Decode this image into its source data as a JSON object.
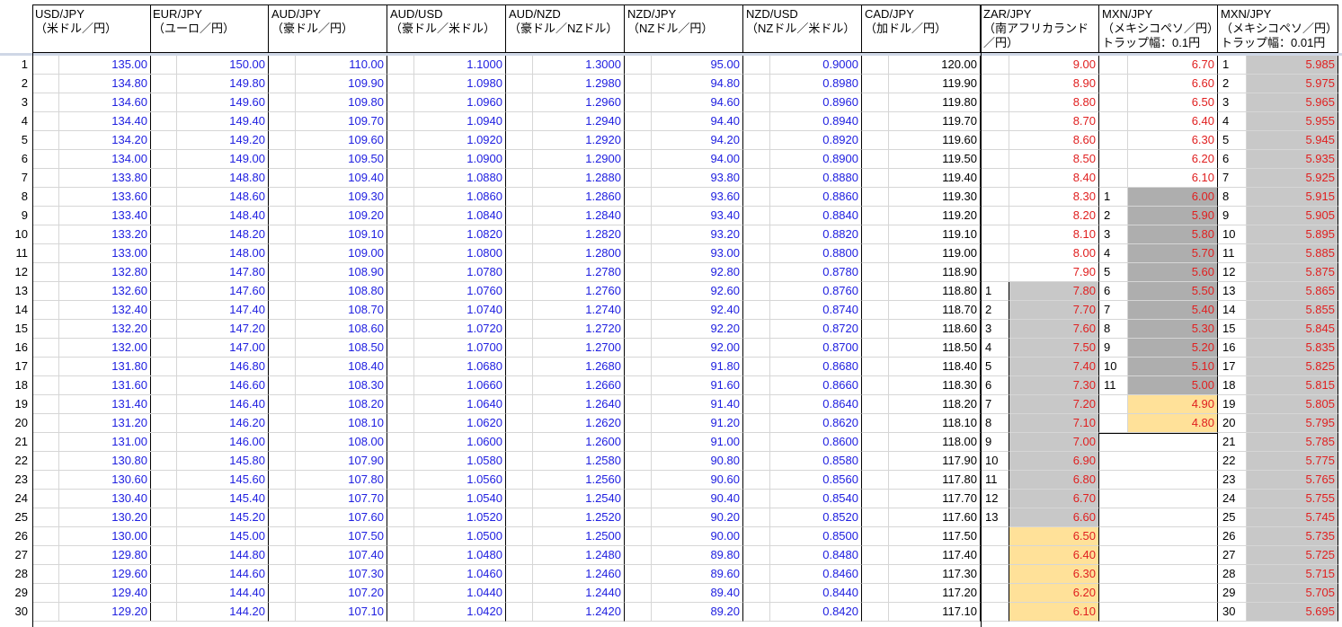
{
  "headers": [
    {
      "l1": "USD/JPY",
      "l2": "（米ドル／円）"
    },
    {
      "l1": "EUR/JPY",
      "l2": "（ユーロ／円）"
    },
    {
      "l1": "AUD/JPY",
      "l2": "（豪ドル／円）"
    },
    {
      "l1": "AUD/USD",
      "l2": "（豪ドル／米ドル）"
    },
    {
      "l1": "AUD/NZD",
      "l2": "（豪ドル／NZドル）"
    },
    {
      "l1": "NZD/JPY",
      "l2": "（NZドル／円）"
    },
    {
      "l1": "NZD/USD",
      "l2": "（NZドル／米ドル）"
    },
    {
      "l1": "CAD/JPY",
      "l2": "（加ドル／円）"
    },
    {
      "l1": "ZAR/JPY",
      "l2": "（南アフリカランド",
      "l3": "／円）"
    },
    {
      "l1": "MXN/JPY",
      "l2": "（メキシコペソ／円）",
      "l3": "トラップ幅：0.1円"
    },
    {
      "l1": "MXN/JPY",
      "l2": "（メキシコペソ／円）",
      "l3": "トラップ幅：0.01円"
    }
  ],
  "rownums": [
    "1",
    "2",
    "3",
    "4",
    "5",
    "6",
    "7",
    "8",
    "9",
    "10",
    "11",
    "12",
    "13",
    "14",
    "15",
    "16",
    "17",
    "18",
    "19",
    "20",
    "21",
    "22",
    "23",
    "24",
    "25",
    "26",
    "27",
    "28",
    "29",
    "30"
  ],
  "usdjpy": [
    "135.00",
    "134.80",
    "134.60",
    "134.40",
    "134.20",
    "134.00",
    "133.80",
    "133.60",
    "133.40",
    "133.20",
    "133.00",
    "132.80",
    "132.60",
    "132.40",
    "132.20",
    "132.00",
    "131.80",
    "131.60",
    "131.40",
    "131.20",
    "131.00",
    "130.80",
    "130.60",
    "130.40",
    "130.20",
    "130.00",
    "129.80",
    "129.60",
    "129.40",
    "129.20"
  ],
  "eurjpy": [
    "150.00",
    "149.80",
    "149.60",
    "149.40",
    "149.20",
    "149.00",
    "148.80",
    "148.60",
    "148.40",
    "148.20",
    "148.00",
    "147.80",
    "147.60",
    "147.40",
    "147.20",
    "147.00",
    "146.80",
    "146.60",
    "146.40",
    "146.20",
    "146.00",
    "145.80",
    "145.60",
    "145.40",
    "145.20",
    "145.00",
    "144.80",
    "144.60",
    "144.40",
    "144.20"
  ],
  "audjpy": [
    "110.00",
    "109.90",
    "109.80",
    "109.70",
    "109.60",
    "109.50",
    "109.40",
    "109.30",
    "109.20",
    "109.10",
    "109.00",
    "108.90",
    "108.80",
    "108.70",
    "108.60",
    "108.50",
    "108.40",
    "108.30",
    "108.20",
    "108.10",
    "108.00",
    "107.90",
    "107.80",
    "107.70",
    "107.60",
    "107.50",
    "107.40",
    "107.30",
    "107.20",
    "107.10"
  ],
  "audusd": [
    "1.1000",
    "1.0980",
    "1.0960",
    "1.0940",
    "1.0920",
    "1.0900",
    "1.0880",
    "1.0860",
    "1.0840",
    "1.0820",
    "1.0800",
    "1.0780",
    "1.0760",
    "1.0740",
    "1.0720",
    "1.0700",
    "1.0680",
    "1.0660",
    "1.0640",
    "1.0620",
    "1.0600",
    "1.0580",
    "1.0560",
    "1.0540",
    "1.0520",
    "1.0500",
    "1.0480",
    "1.0460",
    "1.0440",
    "1.0420"
  ],
  "audnzd": [
    "1.3000",
    "1.2980",
    "1.2960",
    "1.2940",
    "1.2920",
    "1.2900",
    "1.2880",
    "1.2860",
    "1.2840",
    "1.2820",
    "1.2800",
    "1.2780",
    "1.2760",
    "1.2740",
    "1.2720",
    "1.2700",
    "1.2680",
    "1.2660",
    "1.2640",
    "1.2620",
    "1.2600",
    "1.2580",
    "1.2560",
    "1.2540",
    "1.2520",
    "1.2500",
    "1.2480",
    "1.2460",
    "1.2440",
    "1.2420"
  ],
  "nzdjpy": [
    "95.00",
    "94.80",
    "94.60",
    "94.40",
    "94.20",
    "94.00",
    "93.80",
    "93.60",
    "93.40",
    "93.20",
    "93.00",
    "92.80",
    "92.60",
    "92.40",
    "92.20",
    "92.00",
    "91.80",
    "91.60",
    "91.40",
    "91.20",
    "91.00",
    "90.80",
    "90.60",
    "90.40",
    "90.20",
    "90.00",
    "89.80",
    "89.60",
    "89.40",
    "89.20"
  ],
  "nzdusd": [
    "0.9000",
    "0.8980",
    "0.8960",
    "0.8940",
    "0.8920",
    "0.8900",
    "0.8880",
    "0.8860",
    "0.8840",
    "0.8820",
    "0.8800",
    "0.8780",
    "0.8760",
    "0.8740",
    "0.8720",
    "0.8700",
    "0.8680",
    "0.8660",
    "0.8640",
    "0.8620",
    "0.8600",
    "0.8580",
    "0.8560",
    "0.8540",
    "0.8520",
    "0.8500",
    "0.8480",
    "0.8460",
    "0.8440",
    "0.8420"
  ],
  "cadjpy": [
    "120.00",
    "119.90",
    "119.80",
    "119.70",
    "119.60",
    "119.50",
    "119.40",
    "119.30",
    "119.20",
    "119.10",
    "119.00",
    "118.90",
    "118.80",
    "118.70",
    "118.60",
    "118.50",
    "118.40",
    "118.30",
    "118.20",
    "118.10",
    "118.00",
    "117.90",
    "117.80",
    "117.70",
    "117.60",
    "117.50",
    "117.40",
    "117.30",
    "117.20",
    "117.10"
  ],
  "zar_idx": [
    "",
    "",
    "",
    "",
    "",
    "",
    "",
    "",
    "",
    "",
    "",
    "",
    "1",
    "2",
    "3",
    "4",
    "5",
    "6",
    "7",
    "8",
    "9",
    "10",
    "11",
    "12",
    "13",
    "",
    "",
    "",
    "",
    ""
  ],
  "zarjpy": [
    "9.00",
    "8.90",
    "8.80",
    "8.70",
    "8.60",
    "8.50",
    "8.40",
    "8.30",
    "8.20",
    "8.10",
    "8.00",
    "7.90",
    "7.80",
    "7.70",
    "7.60",
    "7.50",
    "7.40",
    "7.30",
    "7.20",
    "7.10",
    "7.00",
    "6.90",
    "6.80",
    "6.70",
    "6.60",
    "6.50",
    "6.40",
    "6.30",
    "6.20",
    "6.10"
  ],
  "mxn1_idx": [
    "",
    "",
    "",
    "",
    "",
    "",
    "",
    "1",
    "2",
    "3",
    "4",
    "5",
    "6",
    "7",
    "8",
    "9",
    "10",
    "11",
    "",
    "",
    "",
    "",
    "",
    "",
    "",
    "",
    "",
    "",
    "",
    ""
  ],
  "mxn1": [
    "6.70",
    "6.60",
    "6.50",
    "6.40",
    "6.30",
    "6.20",
    "6.10",
    "6.00",
    "5.90",
    "5.80",
    "5.70",
    "5.60",
    "5.50",
    "5.40",
    "5.30",
    "5.20",
    "5.10",
    "5.00",
    "4.90",
    "4.80",
    "",
    "",
    "",
    "",
    "",
    "",
    "",
    "",
    "",
    ""
  ],
  "mxn2_idx": [
    "1",
    "2",
    "3",
    "4",
    "5",
    "6",
    "7",
    "8",
    "9",
    "10",
    "11",
    "12",
    "13",
    "14",
    "15",
    "16",
    "17",
    "18",
    "19",
    "20",
    "21",
    "22",
    "23",
    "24",
    "25",
    "26",
    "27",
    "28",
    "29",
    "30"
  ],
  "mxn2": [
    "5.985",
    "5.975",
    "5.965",
    "5.955",
    "5.945",
    "5.935",
    "5.925",
    "5.915",
    "5.905",
    "5.895",
    "5.885",
    "5.875",
    "5.865",
    "5.855",
    "5.845",
    "5.835",
    "5.825",
    "5.815",
    "5.805",
    "5.795",
    "5.785",
    "5.775",
    "5.765",
    "5.755",
    "5.745",
    "5.735",
    "5.725",
    "5.715",
    "5.705",
    "5.695"
  ]
}
